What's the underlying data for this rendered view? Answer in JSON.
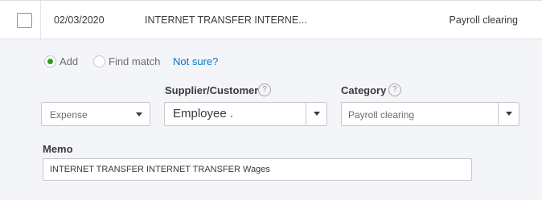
{
  "row": {
    "date": "02/03/2020",
    "description": "INTERNET TRANSFER INTERNE...",
    "category": "Payroll clearing"
  },
  "mode": {
    "add_label": "Add",
    "find_match_label": "Find match",
    "not_sure_label": "Not sure?",
    "selected": "Add"
  },
  "form": {
    "type_value": "Expense",
    "supplier_label": "Supplier/Customer",
    "supplier_value": "Employee .",
    "category_label": "Category",
    "category_value": "Payroll clearing",
    "help_glyph": "?",
    "memo_label": "Memo",
    "memo_value": "INTERNET TRANSFER INTERNET TRANSFER Wages"
  },
  "colors": {
    "accent_green": "#2ca01c",
    "link_blue": "#0077c5"
  },
  "icons": [
    "checkbox-icon",
    "help-icon",
    "chevron-down-icon"
  ]
}
